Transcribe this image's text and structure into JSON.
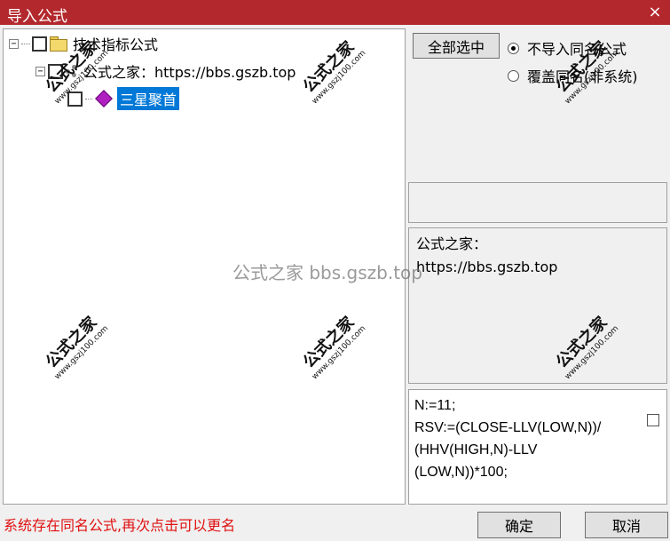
{
  "window": {
    "title": "导入公式",
    "close_glyph": "×"
  },
  "tree": {
    "root": {
      "expander": "−",
      "label": "技术指标公式"
    },
    "group": {
      "expander": "−",
      "label": "公式之家：https://bbs.gszb.top"
    },
    "item": {
      "label": "三星聚首",
      "selected": true
    }
  },
  "actions": {
    "select_all_label": "全部选中",
    "ok_label": "确定",
    "cancel_label": "取消"
  },
  "options": {
    "no_import_label": "不导入同名公式",
    "overwrite_label": "覆盖同名(非系统)",
    "selected": "no_import"
  },
  "description": {
    "text": "公式之家：\nhttps://bbs.gszb.top"
  },
  "code": {
    "text": "N:=11;\nRSV:=(CLOSE-LLV(LOW,N))/\n(HHV(HIGH,N)-LLV\n(LOW,N))*100;"
  },
  "status": {
    "message": "系统存在同名公式,再次点击可以更名"
  },
  "watermark": {
    "center_text": "公式之家 bbs.gszb.top",
    "stamp_title": "公式之家",
    "stamp_url": "www.gszj100.com"
  },
  "colors": {
    "titlebar": "#b3282d",
    "selection": "#0078d7",
    "status": "#e01010"
  }
}
